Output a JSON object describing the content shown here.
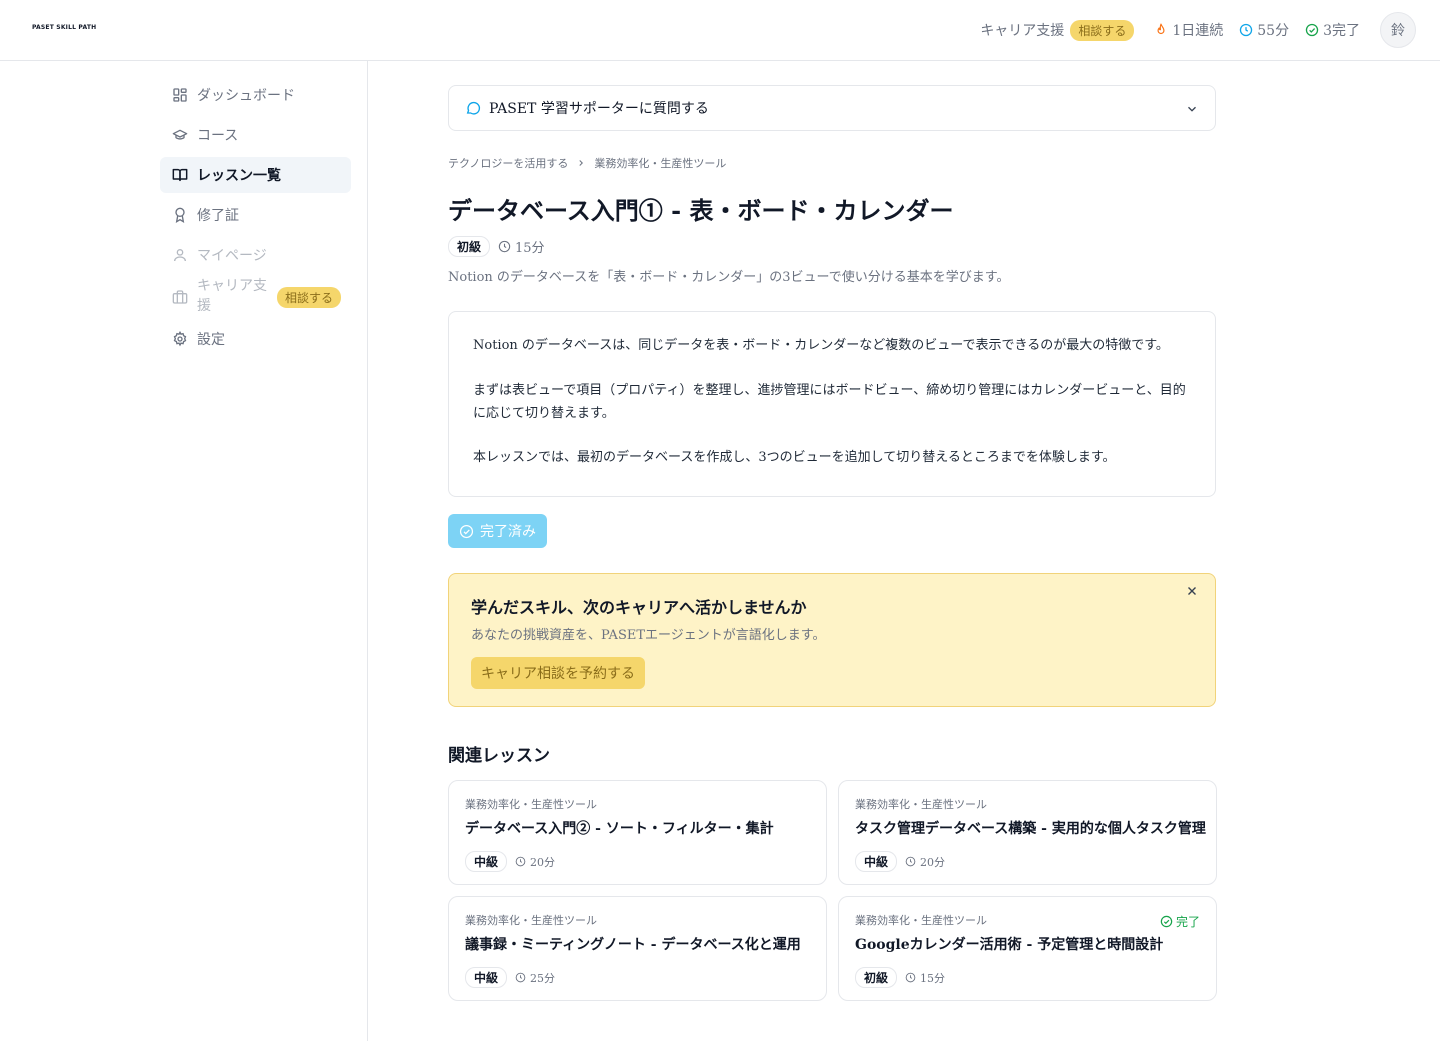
{
  "header": {
    "logo": "PASET SKILL PATH",
    "career_label": "キャリア支援",
    "consult_badge": "相談する",
    "streak": "1日連続",
    "minutes": "55分",
    "completed": "3完了",
    "avatar": "鈴"
  },
  "sidebar": {
    "items": [
      {
        "label": "ダッシュボード",
        "icon": "dashboard-icon"
      },
      {
        "label": "コース",
        "icon": "graduation-cap-icon"
      },
      {
        "label": "レッスン一覧",
        "icon": "book-open-icon"
      },
      {
        "label": "修了証",
        "icon": "award-icon"
      },
      {
        "label": "マイページ",
        "icon": "user-icon"
      },
      {
        "label": "キャリア支援",
        "badge": "相談する",
        "icon": "briefcase-icon"
      },
      {
        "label": "設定",
        "icon": "gear-icon"
      }
    ]
  },
  "main": {
    "assistant_label": "PASET 学習サポーターに質問する",
    "breadcrumb": [
      "テクノロジーを活用する",
      "業務効率化・生産性ツール"
    ],
    "title": "データベース入門① - 表・ボード・カレンダー",
    "level": "初級",
    "duration": "15分",
    "description": "Notion のデータベースを「表・ボード・カレンダー」の3ビューで使い分ける基本を学びます。",
    "content": [
      "Notion のデータベースは、同じデータを表・ボード・カレンダーなど複数のビューで表示できるのが最大の特徴です。",
      "まずは表ビューで項目（プロパティ）を整理し、進捗管理にはボードビュー、締め切り管理にはカレンダービューと、目的に応じて切り替えます。",
      "本レッスンでは、最初のデータベースを作成し、3つのビューを追加して切り替えるところまでを体験します。"
    ],
    "done_button": "完了済み",
    "promo": {
      "title": "学んだスキル、次のキャリアへ活かしませんか",
      "subtitle": "あなたの挑戦資産を、PASETエージェントが言語化します。",
      "button": "キャリア相談を予約する"
    },
    "related_heading": "関連レッスン",
    "related": [
      {
        "category": "業務効率化・生産性ツール",
        "title": "データベース入門② - ソート・フィルター・集計",
        "level": "中級",
        "duration": "20分",
        "done": ""
      },
      {
        "category": "業務効率化・生産性ツール",
        "title": "タスク管理データベース構築 - 実用的な個人タスク管理",
        "level": "中級",
        "duration": "20分",
        "done": ""
      },
      {
        "category": "業務効率化・生産性ツール",
        "title": "議事録・ミーティングノート - データベース化と運用",
        "level": "中級",
        "duration": "25分",
        "done": ""
      },
      {
        "category": "業務効率化・生産性ツール",
        "title": "Googleカレンダー活用術 - 予定管理と時間設計",
        "level": "初級",
        "duration": "15分",
        "done": "完了"
      }
    ]
  },
  "colors": {
    "accent_blue": "#0ea5e9",
    "badge_yellow": "#f5d66b",
    "done_green": "#16a34a",
    "flame_orange": "#f97316"
  }
}
